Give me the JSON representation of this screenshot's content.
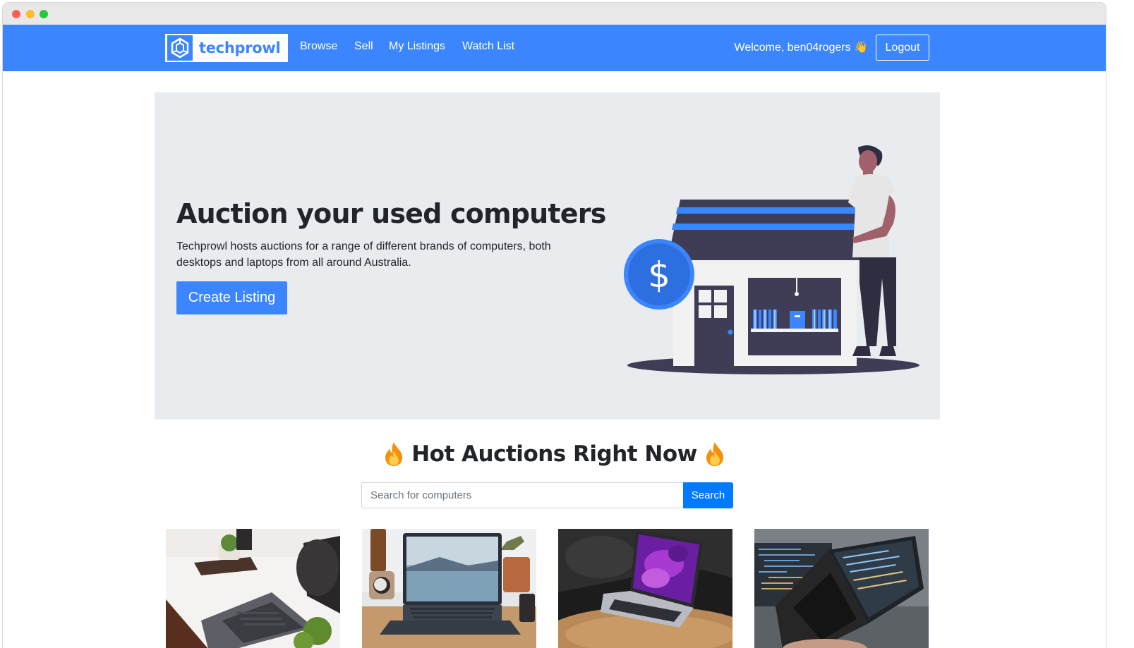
{
  "navbar": {
    "brand": "techprowl",
    "links": [
      "Browse",
      "Sell",
      "My Listings",
      "Watch List"
    ],
    "welcome": "Welcome, ben04rogers 👋",
    "logout": "Logout",
    "bg_color": "#3b86ff"
  },
  "hero": {
    "title": "Auction your used computers",
    "text": "Techprowl hosts auctions for a range of different brands of computers, both desktops and laptops from all around Australia.",
    "button": "Create Listing"
  },
  "hot": {
    "title": "Hot Auctions Right Now",
    "icon": "fire-icon"
  },
  "search": {
    "placeholder": "Search for computers",
    "button": "Search"
  },
  "listings": [
    {
      "image": "laptop-desk-white-photo"
    },
    {
      "image": "laptop-lake-wallpaper-photo"
    },
    {
      "image": "macbook-purple-wallpaper-photo"
    },
    {
      "image": "laptop-code-screen-photo"
    }
  ]
}
